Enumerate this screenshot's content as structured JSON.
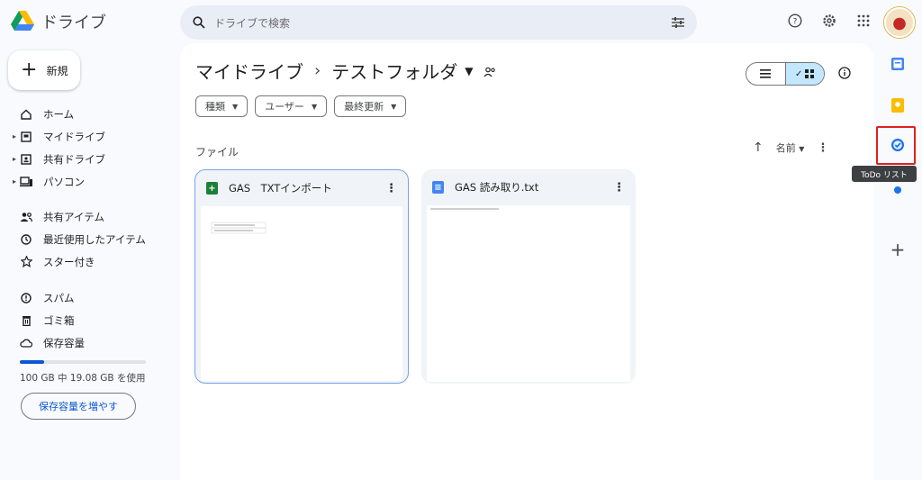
{
  "app": {
    "name": "ドライブ"
  },
  "search": {
    "placeholder": "ドライブで検索"
  },
  "new_button": {
    "label": "新規"
  },
  "nav": {
    "items": [
      {
        "label": "ホーム",
        "icon": "home-icon"
      },
      {
        "label": "マイドライブ",
        "icon": "my-drive-icon"
      },
      {
        "label": "共有ドライブ",
        "icon": "shared-drive-icon"
      },
      {
        "label": "パソコン",
        "icon": "computer-icon"
      },
      {
        "label": "共有アイテム",
        "icon": "shared-people-icon"
      },
      {
        "label": "最近使用したアイテム",
        "icon": "clock-icon"
      },
      {
        "label": "スター付き",
        "icon": "star-icon"
      },
      {
        "label": "スパム",
        "icon": "spam-icon"
      },
      {
        "label": "ゴミ箱",
        "icon": "trash-icon"
      },
      {
        "label": "保存容量",
        "icon": "cloud-icon"
      }
    ]
  },
  "storage": {
    "text": "100 GB 中 19.08 GB を使用",
    "used_fraction": 0.19,
    "button_label": "保存容量を増やす"
  },
  "breadcrumb": {
    "root": "マイドライブ",
    "separator": "›",
    "current": "テストフォルダ"
  },
  "filters": [
    {
      "label": "種類"
    },
    {
      "label": "ユーザー"
    },
    {
      "label": "最終更新"
    }
  ],
  "section": {
    "title": "ファイル"
  },
  "sort": {
    "label": "名前"
  },
  "files": [
    {
      "name": "GAS　TXTインポート",
      "type": "spreadsheet",
      "color": "#188038"
    },
    {
      "name": "GAS 読み取り.txt",
      "type": "document",
      "color": "#4285f4"
    }
  ],
  "side_panel": {
    "tooltip": "ToDo リスト",
    "highlight_color": "#e02020"
  },
  "colors": {
    "accent": "#0b57d0",
    "selected_view": "#c2e7ff"
  }
}
